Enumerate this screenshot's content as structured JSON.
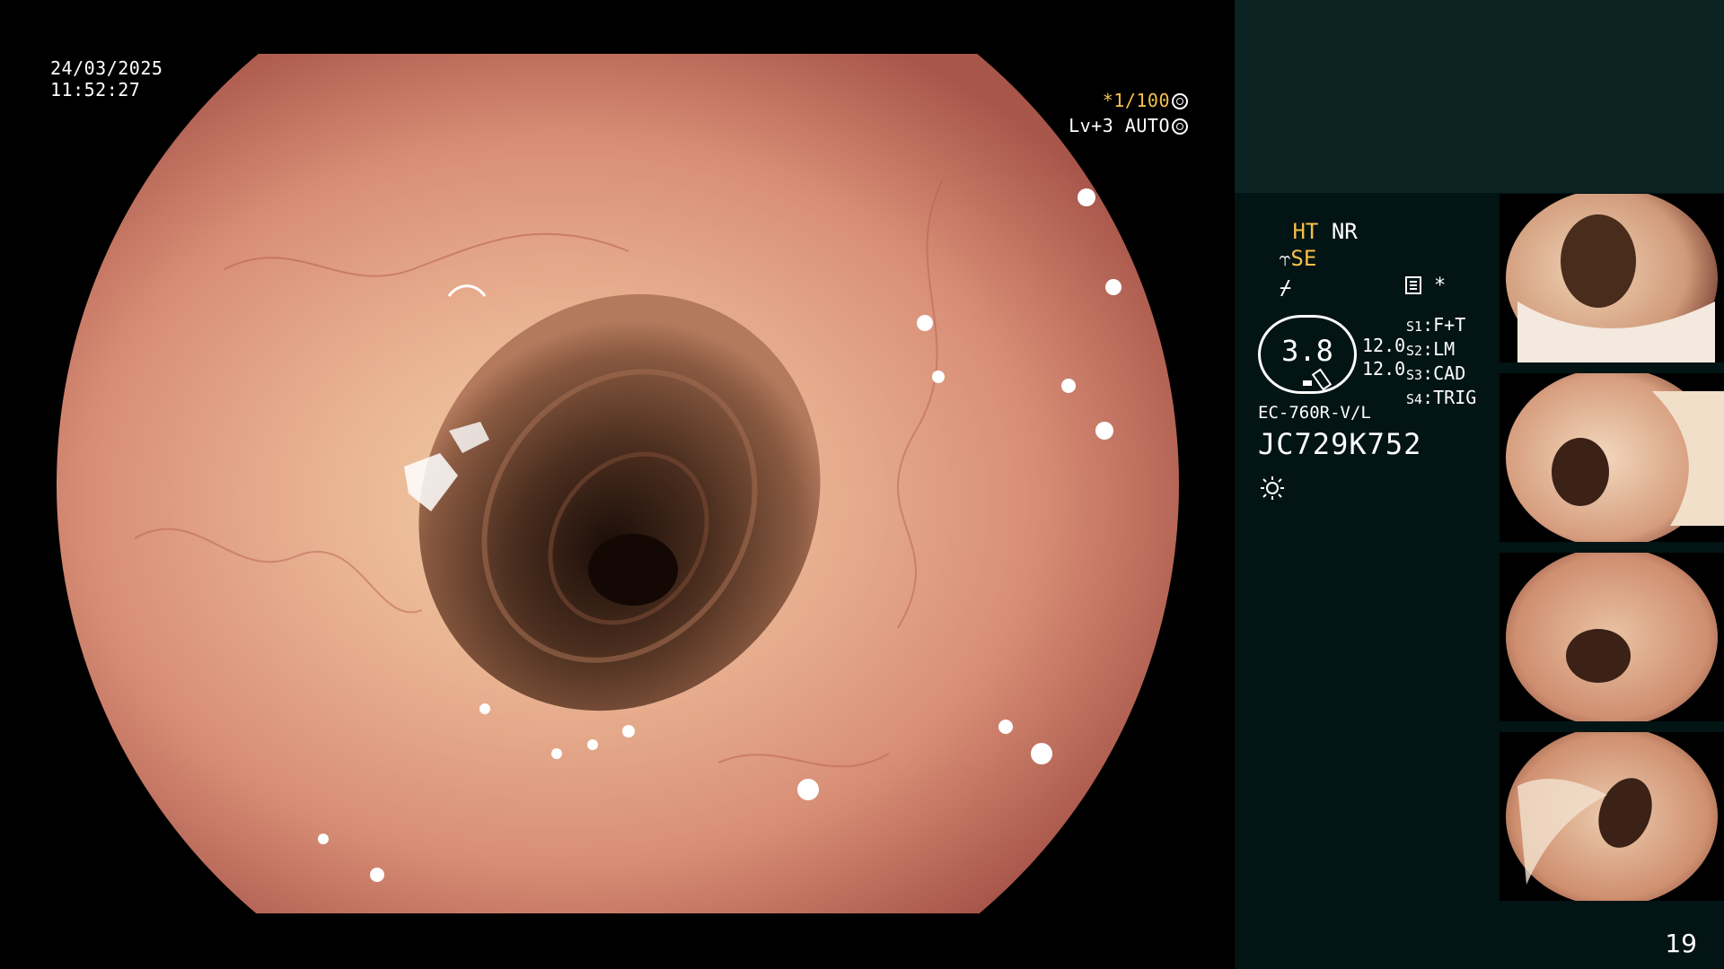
{
  "overlay": {
    "date": "24/03/2025",
    "time": "11:52:27",
    "shutter": "*1/100",
    "level": "Lv+3 AUTO"
  },
  "panel": {
    "ht": "HT",
    "nr": "NR",
    "se": "SE",
    "menu_star": "*",
    "scope_value": "3.8",
    "pressure_1": "12.0",
    "pressure_2": "12.0",
    "switches": [
      {
        "key": "S1",
        "value": "F+T"
      },
      {
        "key": "S2",
        "value": "LM"
      },
      {
        "key": "S3",
        "value": "CAD"
      },
      {
        "key": "S4",
        "value": "TRIG"
      }
    ],
    "scope_model": "EC-760R-V/L",
    "serial": "JC729K752"
  },
  "thumbnails_label": "JC729K752",
  "page_number": "19",
  "colors": {
    "accent": "#f5c04a",
    "panel_bg": "#031414",
    "panel_top_bg": "#0b2323",
    "mucosa": "#d9907a"
  },
  "icons": [
    "shutter-icon",
    "auto-level-icon",
    "menu-icon",
    "light-source-icon"
  ]
}
